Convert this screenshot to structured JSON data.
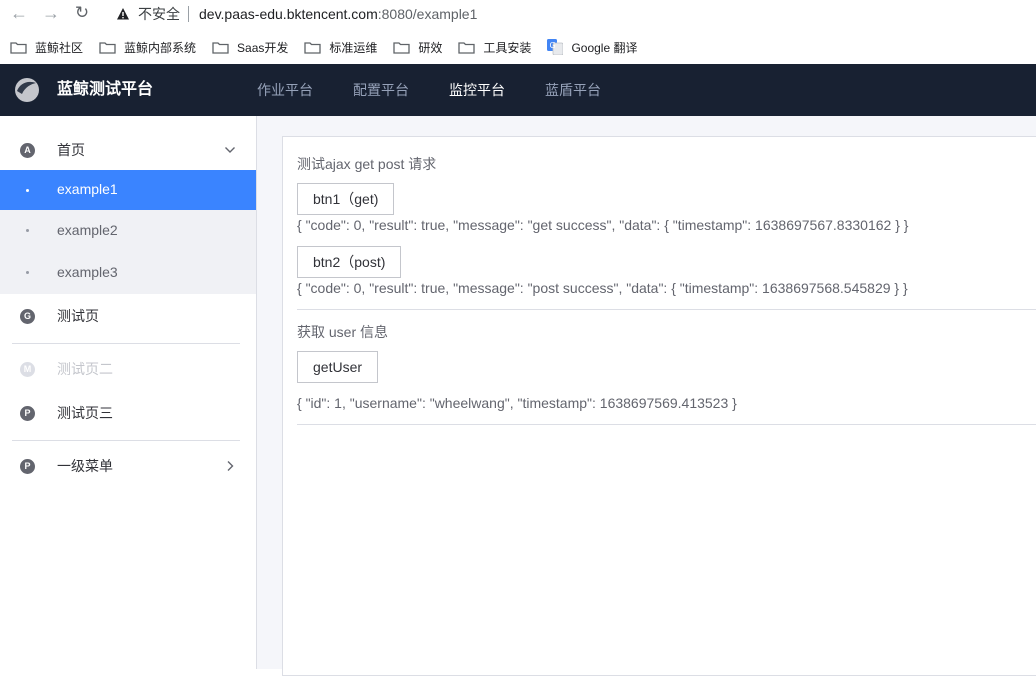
{
  "browser": {
    "insecure_label": "不安全",
    "url_host": "dev.paas-edu.bktencent.com",
    "url_rest": ":8080/example1"
  },
  "bookmarks": [
    {
      "label": "蓝鲸社区"
    },
    {
      "label": "蓝鲸内部系统"
    },
    {
      "label": "Saas开发"
    },
    {
      "label": "标准运维"
    },
    {
      "label": "研效"
    },
    {
      "label": "工具安装"
    },
    {
      "label": "Google 翻译"
    }
  ],
  "header": {
    "app_title": "蓝鲸测试平台",
    "nav": [
      {
        "label": "作业平台"
      },
      {
        "label": "配置平台"
      },
      {
        "label": "监控平台"
      },
      {
        "label": "蓝盾平台"
      }
    ]
  },
  "sidebar": {
    "home": {
      "icon": "A",
      "label": "首页"
    },
    "sub": [
      {
        "label": "example1"
      },
      {
        "label": "example2"
      },
      {
        "label": "example3"
      }
    ],
    "test": {
      "icon": "G",
      "label": "测试页"
    },
    "test2": {
      "icon": "M",
      "label": "测试页二"
    },
    "test3": {
      "icon": "P",
      "label": "测试页三"
    },
    "menu": {
      "icon": "P",
      "label": "一级菜单"
    }
  },
  "main": {
    "ajax_title": "测试ajax get post 请求",
    "btn1_label": "btn1（get)",
    "btn1_result": "{ \"code\": 0, \"result\": true, \"message\": \"get success\", \"data\": { \"timestamp\": 1638697567.8330162 } }",
    "btn2_label": "btn2（post)",
    "btn2_result": "{ \"code\": 0, \"result\": true, \"message\": \"post success\", \"data\": { \"timestamp\": 1638697568.545829 } }",
    "user_title": "获取 user 信息",
    "getuser_label": "getUser",
    "getuser_result": "{ \"id\": 1, \"username\": \"wheelwang\", \"timestamp\": 1638697569.413523 }"
  }
}
